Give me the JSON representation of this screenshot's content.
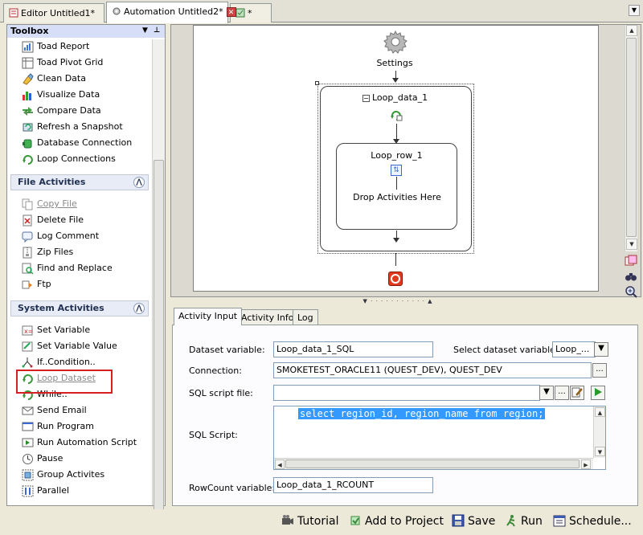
{
  "tabs": [
    {
      "label": "Editor Untitled1*"
    },
    {
      "label": "Automation Untitled2*"
    },
    {
      "label": "*"
    }
  ],
  "toolbox": {
    "title": "Toolbox",
    "top_items": [
      {
        "label": "Toad Report",
        "icon": "report-icon"
      },
      {
        "label": "Toad Pivot Grid",
        "icon": "pivot-grid-icon"
      },
      {
        "label": "Clean Data",
        "icon": "clean-data-icon"
      },
      {
        "label": "Visualize Data",
        "icon": "visualize-data-icon"
      },
      {
        "label": "Compare Data",
        "icon": "compare-data-icon"
      },
      {
        "label": "Refresh a Snapshot",
        "icon": "refresh-snapshot-icon"
      },
      {
        "label": "Database Connection",
        "icon": "database-connection-icon"
      },
      {
        "label": "Loop Connections",
        "icon": "loop-connections-icon"
      }
    ],
    "file_section": {
      "title": "File Activities",
      "items": [
        {
          "label": "Copy File",
          "icon": "copy-file-icon"
        },
        {
          "label": "Delete File",
          "icon": "delete-file-icon"
        },
        {
          "label": "Log Comment",
          "icon": "log-comment-icon"
        },
        {
          "label": "Zip Files",
          "icon": "zip-files-icon"
        },
        {
          "label": "Find and Replace",
          "icon": "find-replace-icon"
        },
        {
          "label": "Ftp",
          "icon": "ftp-icon"
        }
      ]
    },
    "system_section": {
      "title": "System Activities",
      "items": [
        {
          "label": "Set Variable",
          "icon": "set-variable-icon"
        },
        {
          "label": "Set Variable Value",
          "icon": "set-variable-value-icon"
        },
        {
          "label": "If..Condition..",
          "icon": "if-condition-icon"
        },
        {
          "label": "Loop Dataset",
          "icon": "loop-dataset-icon"
        },
        {
          "label": "While..",
          "icon": "while-icon"
        },
        {
          "label": "Send Email",
          "icon": "send-email-icon"
        },
        {
          "label": "Run Program",
          "icon": "run-program-icon"
        },
        {
          "label": "Run Automation Script",
          "icon": "run-automation-script-icon"
        },
        {
          "label": "Pause",
          "icon": "pause-icon"
        },
        {
          "label": "Group Activites",
          "icon": "group-activities-icon"
        },
        {
          "label": "Parallel",
          "icon": "parallel-icon"
        }
      ]
    }
  },
  "designer": {
    "settings_label": "Settings",
    "loop_data_label": "Loop_data_1",
    "loop_row_label": "Loop_row_1",
    "drop_hint": "Drop Activities Here"
  },
  "props": {
    "tabs": [
      "Activity Input",
      "Activity Info",
      "Log"
    ],
    "dataset_variable_label": "Dataset variable:",
    "dataset_variable_value": "Loop_data_1_SQL",
    "select_dataset_label": "Select dataset variable:",
    "select_dataset_value": "Loop_...",
    "connection_label": "Connection:",
    "connection_value": "SMOKETEST_ORACLE11 (QUEST_DEV), QUEST_DEV",
    "sql_file_label": "SQL script file:",
    "sql_file_value": "",
    "sql_script_label": "SQL Script:",
    "sql_script_value": "select region_id, region_name from region;",
    "rowcount_label": "RowCount variable:",
    "rowcount_value": "Loop_data_1_RCOUNT",
    "ellipsis": "..."
  },
  "bottom": {
    "tutorial": "Tutorial",
    "add_to_project": "Add to Project",
    "save": "Save",
    "run": "Run",
    "schedule": "Schedule..."
  },
  "colors": {
    "accent": "#3399ff",
    "highlight": "#d42020",
    "stop": "#e03a1e"
  }
}
